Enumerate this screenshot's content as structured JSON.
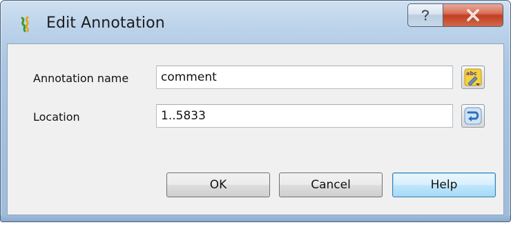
{
  "window": {
    "title": "Edit Annotation",
    "help_glyph": "?",
    "close_glyph": "x"
  },
  "form": {
    "annotation_name_label": "Annotation name",
    "annotation_name_value": "comment",
    "location_label": "Location",
    "location_value": "1..5833"
  },
  "buttons": {
    "ok_label": "OK",
    "cancel_label": "Cancel",
    "help_label": "Help"
  },
  "icons": {
    "app": "annotation-app-icon",
    "name_tool": "text-edit-abc-icon",
    "location_tool": "reverse-complement-icon"
  },
  "colors": {
    "titlebar": "#a9c6e4",
    "client_background": "#f0f0f0",
    "close_button": "#c8472a",
    "default_button_border": "#3c7fb1"
  }
}
